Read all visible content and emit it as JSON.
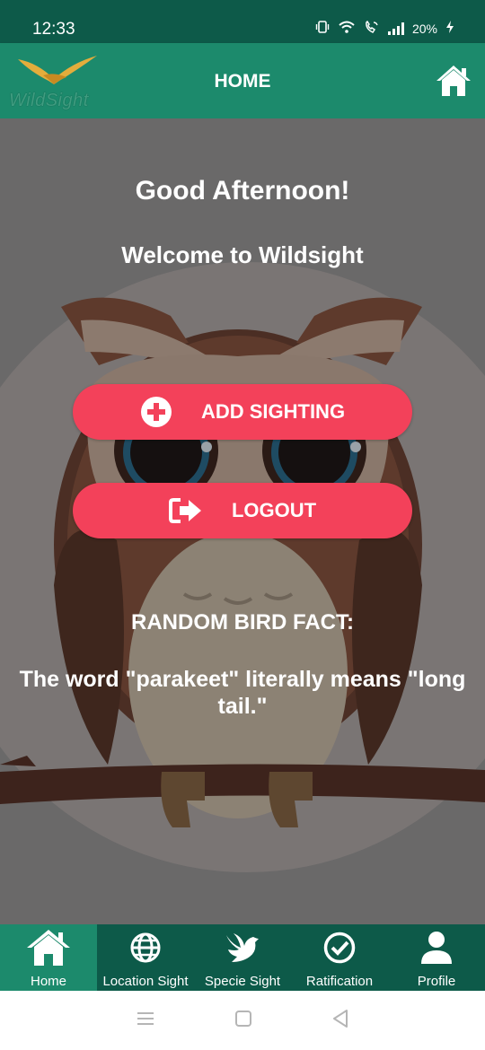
{
  "status_bar": {
    "time": "12:33",
    "battery": "20%"
  },
  "app_bar": {
    "logo_text": "WildSight",
    "title": "HOME"
  },
  "main": {
    "greeting": "Good Afternoon!",
    "welcome": "Welcome to Wildsight",
    "add_sighting_label": "ADD SIGHTING",
    "logout_label": "LOGOUT",
    "fact_title": "RANDOM BIRD FACT:",
    "fact_text": "The word \"parakeet\" literally means \"long tail.\""
  },
  "bottom_nav": {
    "items": [
      {
        "label": "Home",
        "icon": "home-icon",
        "active": true
      },
      {
        "label": "Location Sight",
        "icon": "globe-icon",
        "active": false
      },
      {
        "label": "Specie Sight",
        "icon": "dove-icon",
        "active": false
      },
      {
        "label": "Ratification",
        "icon": "check-circle-icon",
        "active": false
      },
      {
        "label": "Profile",
        "icon": "user-icon",
        "active": false
      }
    ]
  },
  "colors": {
    "status_bar": "#0d5a49",
    "app_bar": "#1c8a6c",
    "button": "#f3415a",
    "overlay": "#6a6969",
    "nav_active": "#1c8a6c"
  }
}
